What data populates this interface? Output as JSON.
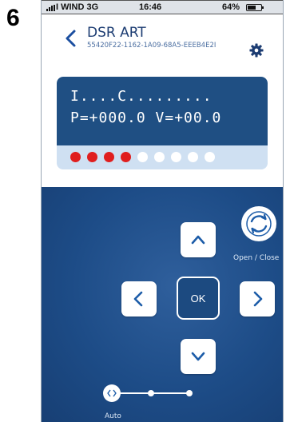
{
  "step_number": "6",
  "status_bar": {
    "carrier": "I WIND  3G",
    "time": "16:46",
    "battery": "64%",
    "battery_level": 0.64
  },
  "header": {
    "device_name": "DSR ART",
    "device_id": "55420F22-1162-1A09-68A5-EEEB4E2I"
  },
  "display": {
    "line1": "I....C.........",
    "line2": "P=+000.0 V=+00.0",
    "leds": [
      "red",
      "red",
      "red",
      "red",
      "white",
      "white",
      "white",
      "white",
      "white"
    ]
  },
  "controls": {
    "ok_label": "OK",
    "open_close_label": "Open / Close",
    "auto_label": "Auto"
  },
  "colors": {
    "accent": "#1c3c72",
    "lcd_background": "#1f4f83",
    "led_red": "#e01e1e",
    "led_white": "#ffffff"
  }
}
